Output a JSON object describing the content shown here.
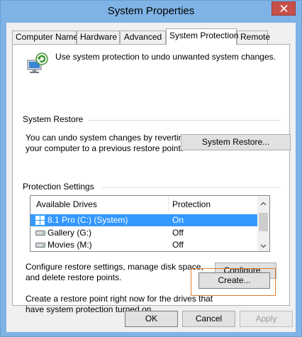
{
  "window": {
    "title": "System Properties"
  },
  "tabs": [
    {
      "label": "Computer Name"
    },
    {
      "label": "Hardware"
    },
    {
      "label": "Advanced"
    },
    {
      "label": "System Protection"
    },
    {
      "label": "Remote"
    }
  ],
  "intro": {
    "text": "Use system protection to undo unwanted system changes."
  },
  "system_restore": {
    "group_title": "System Restore",
    "description_line1": "You can undo system changes by reverting",
    "description_line2": "your computer to a previous restore point.",
    "button_label": "System Restore..."
  },
  "protection_settings": {
    "group_title": "Protection Settings",
    "columns": [
      "Available Drives",
      "Protection"
    ],
    "rows": [
      {
        "drive": "8.1 Pro (C:) (System)",
        "protection": "On",
        "icon": "windows-drive-icon",
        "selected": true
      },
      {
        "drive": "Gallery (G:)",
        "protection": "Off",
        "icon": "hard-drive-icon",
        "selected": false
      },
      {
        "drive": "Movies (M:)",
        "protection": "Off",
        "icon": "hard-drive-icon",
        "selected": false
      }
    ],
    "configure_line1": "Configure restore settings, manage disk space,",
    "configure_line2": "and delete restore points.",
    "configure_label": "Configure...",
    "create_line1": "Create a restore point right now for the drives that",
    "create_line2": "have system protection turned on.",
    "create_label": "Create..."
  },
  "footer": {
    "ok_label": "OK",
    "cancel_label": "Cancel",
    "apply_label": "Apply"
  },
  "colors": {
    "titlebar": "#7fb2e5",
    "close": "#c7504a",
    "selection": "#3399ff",
    "highlight": "#e07a28"
  }
}
